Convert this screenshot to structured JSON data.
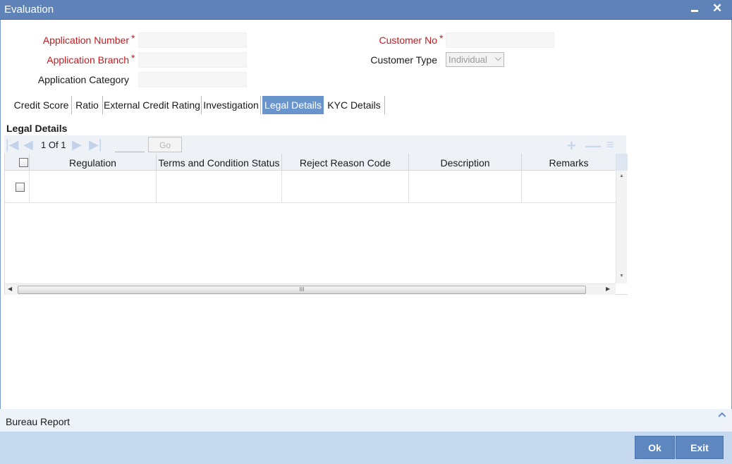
{
  "window": {
    "title": "Evaluation",
    "minimize_glyph": "▬",
    "close_glyph": "✕"
  },
  "form": {
    "application_number": {
      "label": "Application Number",
      "required_mark": "*",
      "value": ""
    },
    "application_branch": {
      "label": "Application Branch",
      "required_mark": "*",
      "value": ""
    },
    "application_category": {
      "label": "Application Category",
      "value": ""
    },
    "customer_no": {
      "label": "Customer No",
      "required_mark": "*",
      "value": ""
    },
    "customer_type": {
      "label": "Customer Type",
      "value": "Individual"
    }
  },
  "tabs": [
    {
      "label": "Credit Score",
      "active": false
    },
    {
      "label": "Ratio",
      "active": false
    },
    {
      "label": "External Credit Rating",
      "active": false
    },
    {
      "label": "Investigation",
      "active": false
    },
    {
      "label": "Legal Details",
      "active": true
    },
    {
      "label": "KYC Details",
      "active": false
    }
  ],
  "section": {
    "title": "Legal Details"
  },
  "grid": {
    "pagination": {
      "current": "1",
      "of_label": "Of",
      "total": "1",
      "go_label": "Go"
    },
    "columns": [
      "Regulation",
      "Terms and Condition Status",
      "Reject Reason Code",
      "Description",
      "Remarks"
    ],
    "scroll_thumb_glyph": "III"
  },
  "bureau": {
    "label": "Bureau Report"
  },
  "footer": {
    "ok_label": "Ok",
    "exit_label": "Exit"
  },
  "colors": {
    "titlebar": "#5f83b8",
    "accent": "#6a95cc",
    "required": "#c8181e",
    "footer": "#c6d9ef"
  }
}
